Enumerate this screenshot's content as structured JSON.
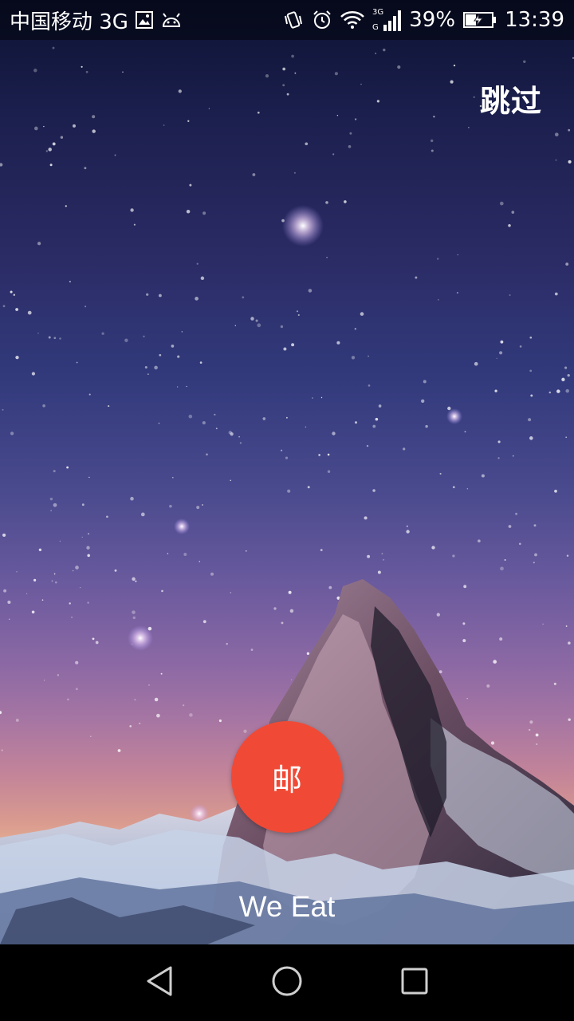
{
  "status_bar": {
    "carrier": "中国移动 3G",
    "network_small": "3G",
    "battery_percent": "39%",
    "time": "13:39"
  },
  "skip_label": "跳过",
  "logo_char": "邮",
  "app_name": "We Eat",
  "colors": {
    "logo": "#f04a36",
    "status_bar": "#2b2b3a",
    "nav_bar": "#000000"
  },
  "icons": [
    "picture-icon",
    "android-icon",
    "vibrate-icon",
    "alarm-icon",
    "wifi-icon",
    "signal-icon",
    "battery-charging-icon",
    "back-icon",
    "home-icon",
    "recents-icon"
  ]
}
